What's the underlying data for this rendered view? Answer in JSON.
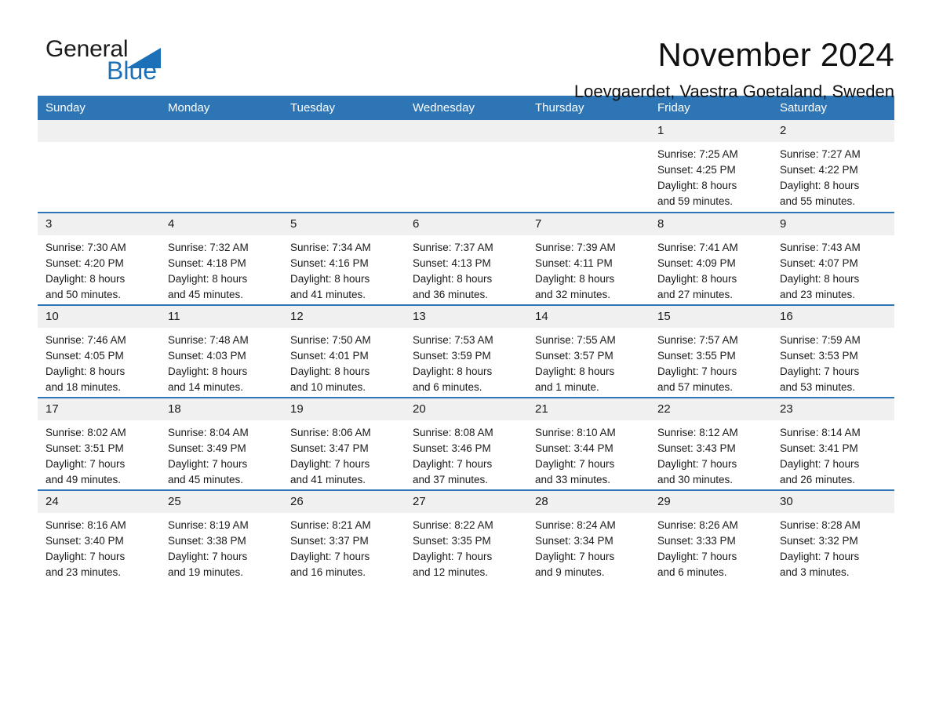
{
  "brand": {
    "word_one": "General",
    "word_two": "Blue",
    "triangle_icon": "triangle-icon",
    "accent_color": "#1b70b8"
  },
  "header": {
    "month_title": "November 2024",
    "location": "Loevgaerdet, Vaestra Goetaland, Sweden"
  },
  "calendar": {
    "header_bg": "#2e75b6",
    "daynum_bg": "#f0f0f0",
    "weekday_headers": [
      "Sunday",
      "Monday",
      "Tuesday",
      "Wednesday",
      "Thursday",
      "Friday",
      "Saturday"
    ],
    "weeks": [
      [
        {
          "day": "",
          "lines": []
        },
        {
          "day": "",
          "lines": []
        },
        {
          "day": "",
          "lines": []
        },
        {
          "day": "",
          "lines": []
        },
        {
          "day": "",
          "lines": []
        },
        {
          "day": "1",
          "lines": [
            "Sunrise: 7:25 AM",
            "Sunset: 4:25 PM",
            "Daylight: 8 hours",
            "and 59 minutes."
          ]
        },
        {
          "day": "2",
          "lines": [
            "Sunrise: 7:27 AM",
            "Sunset: 4:22 PM",
            "Daylight: 8 hours",
            "and 55 minutes."
          ]
        }
      ],
      [
        {
          "day": "3",
          "lines": [
            "Sunrise: 7:30 AM",
            "Sunset: 4:20 PM",
            "Daylight: 8 hours",
            "and 50 minutes."
          ]
        },
        {
          "day": "4",
          "lines": [
            "Sunrise: 7:32 AM",
            "Sunset: 4:18 PM",
            "Daylight: 8 hours",
            "and 45 minutes."
          ]
        },
        {
          "day": "5",
          "lines": [
            "Sunrise: 7:34 AM",
            "Sunset: 4:16 PM",
            "Daylight: 8 hours",
            "and 41 minutes."
          ]
        },
        {
          "day": "6",
          "lines": [
            "Sunrise: 7:37 AM",
            "Sunset: 4:13 PM",
            "Daylight: 8 hours",
            "and 36 minutes."
          ]
        },
        {
          "day": "7",
          "lines": [
            "Sunrise: 7:39 AM",
            "Sunset: 4:11 PM",
            "Daylight: 8 hours",
            "and 32 minutes."
          ]
        },
        {
          "day": "8",
          "lines": [
            "Sunrise: 7:41 AM",
            "Sunset: 4:09 PM",
            "Daylight: 8 hours",
            "and 27 minutes."
          ]
        },
        {
          "day": "9",
          "lines": [
            "Sunrise: 7:43 AM",
            "Sunset: 4:07 PM",
            "Daylight: 8 hours",
            "and 23 minutes."
          ]
        }
      ],
      [
        {
          "day": "10",
          "lines": [
            "Sunrise: 7:46 AM",
            "Sunset: 4:05 PM",
            "Daylight: 8 hours",
            "and 18 minutes."
          ]
        },
        {
          "day": "11",
          "lines": [
            "Sunrise: 7:48 AM",
            "Sunset: 4:03 PM",
            "Daylight: 8 hours",
            "and 14 minutes."
          ]
        },
        {
          "day": "12",
          "lines": [
            "Sunrise: 7:50 AM",
            "Sunset: 4:01 PM",
            "Daylight: 8 hours",
            "and 10 minutes."
          ]
        },
        {
          "day": "13",
          "lines": [
            "Sunrise: 7:53 AM",
            "Sunset: 3:59 PM",
            "Daylight: 8 hours",
            "and 6 minutes."
          ]
        },
        {
          "day": "14",
          "lines": [
            "Sunrise: 7:55 AM",
            "Sunset: 3:57 PM",
            "Daylight: 8 hours",
            "and 1 minute."
          ]
        },
        {
          "day": "15",
          "lines": [
            "Sunrise: 7:57 AM",
            "Sunset: 3:55 PM",
            "Daylight: 7 hours",
            "and 57 minutes."
          ]
        },
        {
          "day": "16",
          "lines": [
            "Sunrise: 7:59 AM",
            "Sunset: 3:53 PM",
            "Daylight: 7 hours",
            "and 53 minutes."
          ]
        }
      ],
      [
        {
          "day": "17",
          "lines": [
            "Sunrise: 8:02 AM",
            "Sunset: 3:51 PM",
            "Daylight: 7 hours",
            "and 49 minutes."
          ]
        },
        {
          "day": "18",
          "lines": [
            "Sunrise: 8:04 AM",
            "Sunset: 3:49 PM",
            "Daylight: 7 hours",
            "and 45 minutes."
          ]
        },
        {
          "day": "19",
          "lines": [
            "Sunrise: 8:06 AM",
            "Sunset: 3:47 PM",
            "Daylight: 7 hours",
            "and 41 minutes."
          ]
        },
        {
          "day": "20",
          "lines": [
            "Sunrise: 8:08 AM",
            "Sunset: 3:46 PM",
            "Daylight: 7 hours",
            "and 37 minutes."
          ]
        },
        {
          "day": "21",
          "lines": [
            "Sunrise: 8:10 AM",
            "Sunset: 3:44 PM",
            "Daylight: 7 hours",
            "and 33 minutes."
          ]
        },
        {
          "day": "22",
          "lines": [
            "Sunrise: 8:12 AM",
            "Sunset: 3:43 PM",
            "Daylight: 7 hours",
            "and 30 minutes."
          ]
        },
        {
          "day": "23",
          "lines": [
            "Sunrise: 8:14 AM",
            "Sunset: 3:41 PM",
            "Daylight: 7 hours",
            "and 26 minutes."
          ]
        }
      ],
      [
        {
          "day": "24",
          "lines": [
            "Sunrise: 8:16 AM",
            "Sunset: 3:40 PM",
            "Daylight: 7 hours",
            "and 23 minutes."
          ]
        },
        {
          "day": "25",
          "lines": [
            "Sunrise: 8:19 AM",
            "Sunset: 3:38 PM",
            "Daylight: 7 hours",
            "and 19 minutes."
          ]
        },
        {
          "day": "26",
          "lines": [
            "Sunrise: 8:21 AM",
            "Sunset: 3:37 PM",
            "Daylight: 7 hours",
            "and 16 minutes."
          ]
        },
        {
          "day": "27",
          "lines": [
            "Sunrise: 8:22 AM",
            "Sunset: 3:35 PM",
            "Daylight: 7 hours",
            "and 12 minutes."
          ]
        },
        {
          "day": "28",
          "lines": [
            "Sunrise: 8:24 AM",
            "Sunset: 3:34 PM",
            "Daylight: 7 hours",
            "and 9 minutes."
          ]
        },
        {
          "day": "29",
          "lines": [
            "Sunrise: 8:26 AM",
            "Sunset: 3:33 PM",
            "Daylight: 7 hours",
            "and 6 minutes."
          ]
        },
        {
          "day": "30",
          "lines": [
            "Sunrise: 8:28 AM",
            "Sunset: 3:32 PM",
            "Daylight: 7 hours",
            "and 3 minutes."
          ]
        }
      ]
    ]
  }
}
